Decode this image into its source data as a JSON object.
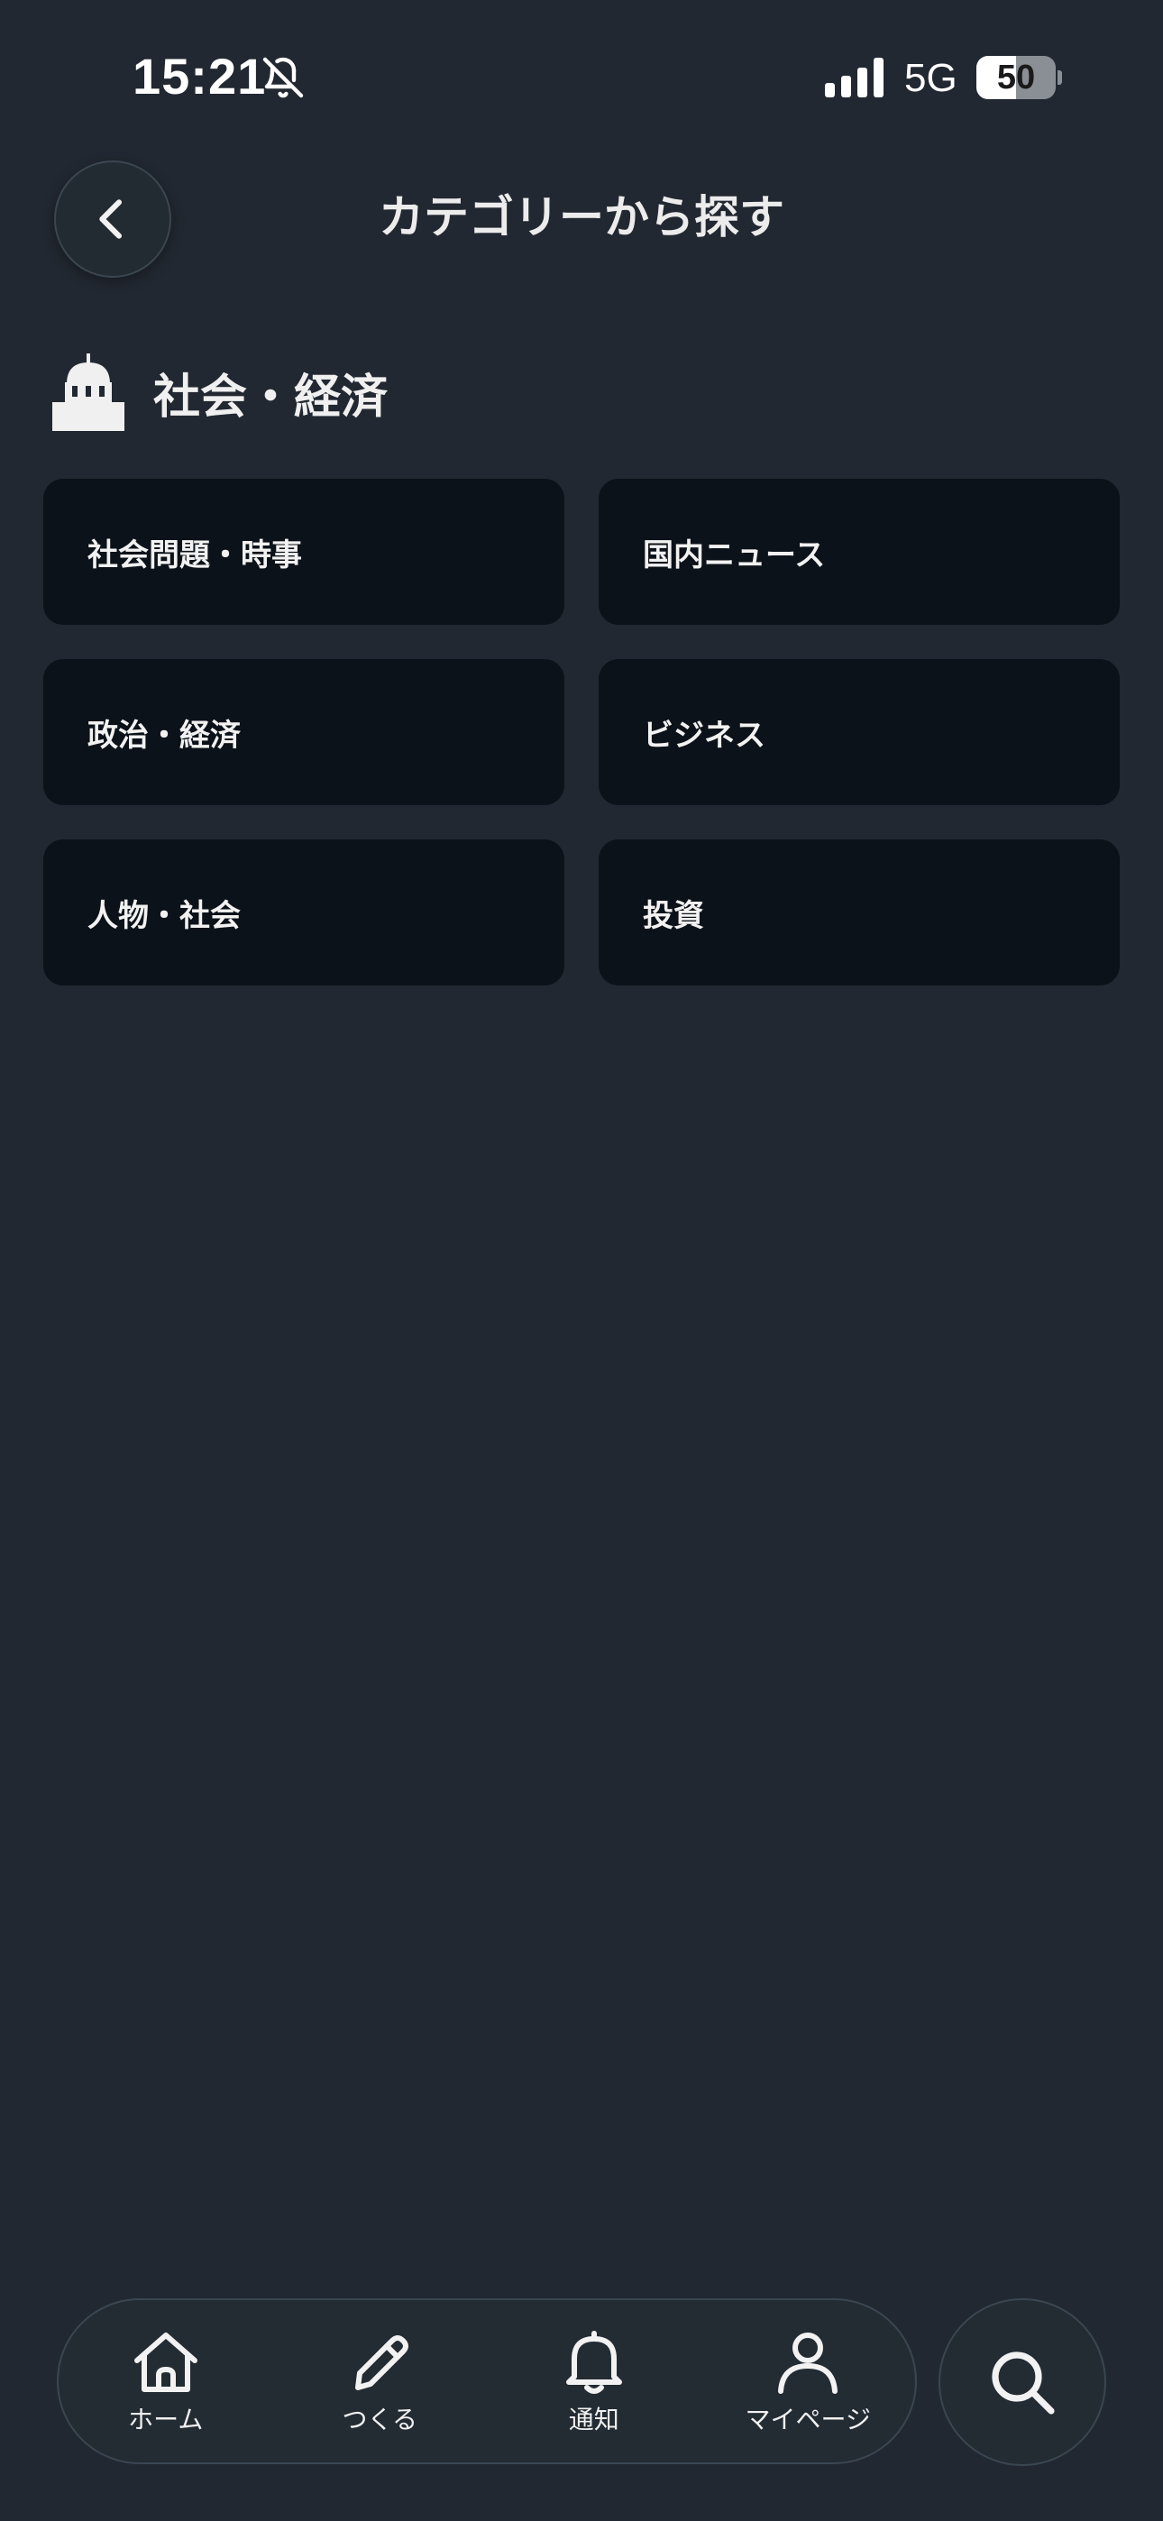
{
  "status_bar": {
    "time": "15:21",
    "network": "5G",
    "battery_level": "50",
    "battery_fraction": 0.5,
    "icons": [
      "bell-off-icon",
      "signal-bars-icon",
      "battery-icon"
    ]
  },
  "header": {
    "title": "カテゴリーから探す",
    "back_icon": "chevron-left-icon"
  },
  "section": {
    "icon": "government-building-icon",
    "title": "社会・経済"
  },
  "categories": [
    {
      "label": "社会問題・時事"
    },
    {
      "label": "国内ニュース"
    },
    {
      "label": "政治・経済"
    },
    {
      "label": "ビジネス"
    },
    {
      "label": "人物・社会"
    },
    {
      "label": "投資"
    }
  ],
  "bottom_nav": {
    "items": [
      {
        "label": "ホーム",
        "icon": "home-icon"
      },
      {
        "label": "つくる",
        "icon": "pencil-icon"
      },
      {
        "label": "通知",
        "icon": "bell-icon"
      },
      {
        "label": "マイページ",
        "icon": "user-icon"
      }
    ],
    "search_icon": "search-icon"
  },
  "colors": {
    "background": "#222831",
    "card": "#0c1219",
    "text": "#ececec",
    "nav_border": "#3a4651"
  }
}
